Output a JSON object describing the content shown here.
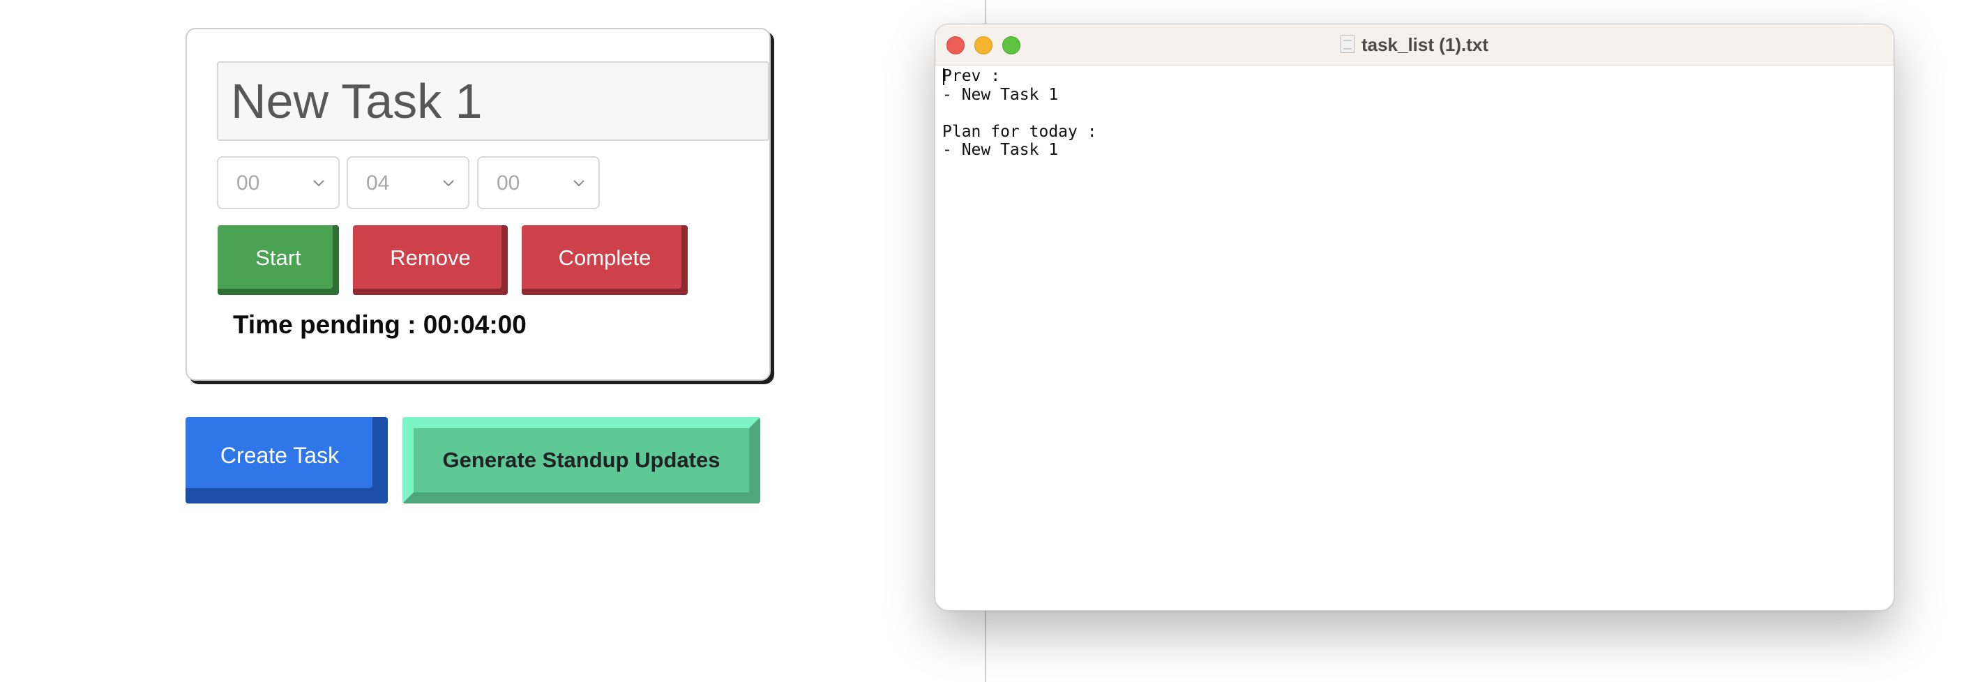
{
  "task_card": {
    "task_name": "New Task 1",
    "time": {
      "hours": "00",
      "minutes": "04",
      "seconds": "00"
    },
    "buttons": {
      "start": "Start",
      "remove": "Remove",
      "complete": "Complete"
    },
    "time_pending": "Time pending : 00:04:00"
  },
  "actions": {
    "create_task": "Create Task",
    "generate_standup": "Generate Standup Updates"
  },
  "text_window": {
    "title": "task_list (1).txt",
    "content": "Prev :\n- New Task 1\n\nPlan for today :\n- New Task 1"
  },
  "colors": {
    "start": "#4aa352",
    "remove": "#cf414a",
    "complete": "#cf414a",
    "create_task": "#2f77e8",
    "generate_standup": "#5ec897"
  }
}
